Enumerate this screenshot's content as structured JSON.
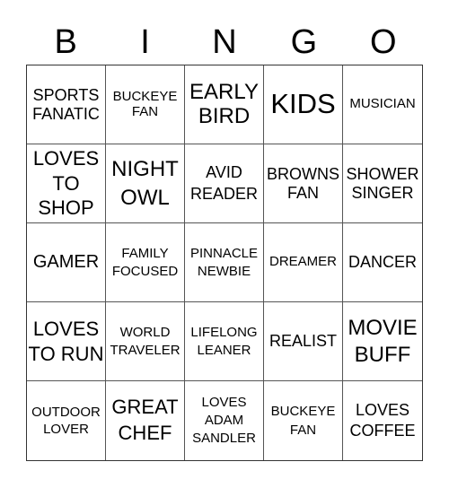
{
  "header": {
    "letters": [
      "B",
      "I",
      "N",
      "G",
      "O"
    ]
  },
  "board": {
    "rows": [
      [
        "SPORTS FANATIC",
        "BUCKEYE FAN",
        "EARLY BIRD",
        "KIDS",
        "MUSICIAN"
      ],
      [
        "LOVES TO SHOP",
        "NIGHT OWL",
        "AVID READER",
        "BROWNS FAN",
        "SHOWER SINGER"
      ],
      [
        "GAMER",
        "FAMILY FOCUSED",
        "PINNACLE NEWBIE",
        "DREAMER",
        "DANCER"
      ],
      [
        "LOVES TO RUN",
        "WORLD TRAVELER",
        "LIFELONG LEANER",
        "REALIST",
        "MOVIE BUFF"
      ],
      [
        "OUTDOOR LOVER",
        "GREAT CHEF",
        "LOVES ADAM SANDLER",
        "BUCKEYE FAN",
        "LOVES COFFEE"
      ]
    ]
  }
}
